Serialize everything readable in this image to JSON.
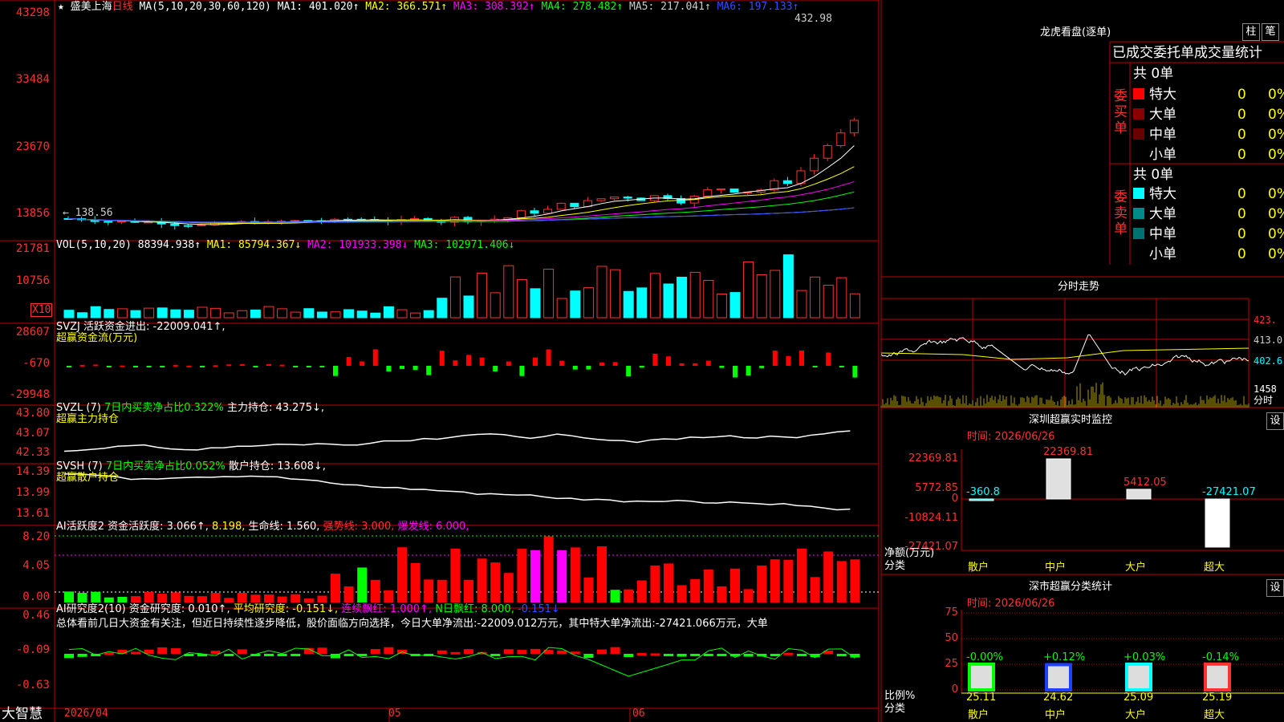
{
  "stock": {
    "name": "盛美上海",
    "period": "日线",
    "star": "★"
  },
  "main_panel": {
    "ma_label": "MA(5,10,20,30,60,120)",
    "ma1": "MA1: 401.020↑",
    "ma2": "MA2: 366.571↑",
    "ma3": "MA3: 308.392↑",
    "ma4": "MA4: 278.482↑",
    "ma5": "MA5: 217.041↑",
    "ma6": "MA6: 197.133↑",
    "yaxis": [
      "43298",
      "33484",
      "23670",
      "13856"
    ],
    "high_label": "432.98",
    "low_label": "← 138.56"
  },
  "vol_panel": {
    "title": "VOL(5,10,20)",
    "value": "88394.938↑",
    "ma1": "MA1: 85794.367↓",
    "ma2": "MA2: 101933.398↓",
    "ma3": "MA3: 102971.406↓",
    "yaxis": [
      "21781",
      "10756"
    ],
    "unit": "X10"
  },
  "svzj_panel": {
    "title": "SVZJ  活跃资金进出: -22009.041↑,",
    "subtitle": "超赢资金流(万元)",
    "yaxis": [
      "28607",
      "-670",
      "-29948"
    ]
  },
  "svzl_panel": {
    "title": "SVZL (7)",
    "ratio": "7日内买卖净占比0.322%",
    "hold": "主力持仓: 43.275↓,",
    "subtitle": "超赢主力持仓",
    "yaxis": [
      "43.80",
      "43.07",
      "42.33"
    ]
  },
  "svsh_panel": {
    "title": "SVSH (7)",
    "ratio": "7日内买卖净占比0.052%",
    "hold": "散户持仓: 13.608↓,",
    "subtitle": "超赢散户持仓",
    "yaxis": [
      "14.39",
      "13.99",
      "13.61"
    ]
  },
  "ai_active_panel": {
    "title": "AI活跃度2",
    "active": "资金活跃度: 3.066↑,",
    "v2": "8.198,",
    "life": "生命线: 1.560,",
    "strong": "强势线: 3.000,",
    "burst": "爆发线: 6.000,",
    "yaxis": [
      "8.20",
      "4.05",
      "0.00"
    ]
  },
  "ai_research_panel": {
    "title": "AI研究度2(10)",
    "research": "资金研究度: 0.010↑,",
    "avg": "平均研究度: -0.151↓,",
    "red": "连续飘红: 1.000↑,",
    "nred": "N日飘红: 8.000,",
    "last": "-0.151↓",
    "summary": "总体看前几日大资金有关注，但近日持续性逐步降低，股价面临方向选择，今日大单净流出:-22009.012万元，其中特大单净流出:-27421.066万元，大单",
    "yaxis": [
      "0.46",
      "-0.09",
      "-0.63"
    ]
  },
  "bottom_axis": {
    "brand": "大智慧",
    "dates": [
      "2026/04",
      "05",
      "06"
    ]
  },
  "dragon_tiger": {
    "title": "龙虎看盘(逐单)",
    "btn_bar": "柱",
    "btn_pen": "笔",
    "header": "已成交委托单成交量统计",
    "buy": {
      "side": "委买单",
      "total": "共 0单",
      "rows": [
        {
          "name": "特大",
          "count": "0",
          "pct": "0%"
        },
        {
          "name": "大单",
          "count": "0",
          "pct": "0%"
        },
        {
          "name": "中单",
          "count": "0",
          "pct": "0%"
        },
        {
          "name": "小单",
          "count": "0",
          "pct": "0%"
        }
      ]
    },
    "sell": {
      "side": "委卖单",
      "total": "共 0单",
      "rows": [
        {
          "name": "特大",
          "count": "0",
          "pct": "0%"
        },
        {
          "name": "大单",
          "count": "0",
          "pct": "0%"
        },
        {
          "name": "中单",
          "count": "0",
          "pct": "0%"
        },
        {
          "name": "小单",
          "count": "0",
          "pct": "0%"
        }
      ]
    },
    "colors": {
      "buy": [
        "#ff0000",
        "#8b0000",
        "#6b0000",
        "#000000"
      ],
      "sell": [
        "#00ffff",
        "#008b8b",
        "#007070",
        "#000000"
      ]
    }
  },
  "intraday": {
    "title": "分时走势",
    "yaxis": [
      "423.",
      "413.0",
      "402.6"
    ],
    "vol_label": "1458",
    "unit": "分时"
  },
  "sz_monitor": {
    "title": "深圳超赢实时监控",
    "btn": "设",
    "time": "时间: 2026/06/26",
    "yaxis": [
      "22369.81",
      "5772.85",
      "0",
      "-10824.11",
      "-27421.07"
    ],
    "left_label1": "净额(万元)",
    "left_label2": "分类",
    "categories": [
      "散户",
      "中户",
      "大户",
      "超大"
    ],
    "bar_labels": [
      "-360.8",
      "22369.81",
      "5412.05",
      "-27421.07"
    ]
  },
  "sz_stats": {
    "title": "深市超赢分类统计",
    "btn": "设",
    "time": "时间: 2026/06/26",
    "yaxis": [
      "75",
      "50",
      "25",
      "0"
    ],
    "left_label1": "比例%",
    "left_label2": "分类",
    "categories": [
      "散户",
      "中户",
      "大户",
      "超大"
    ],
    "changes": [
      "-0.00%",
      "+0.12%",
      "+0.03%",
      "-0.14%"
    ],
    "values": [
      "25.11",
      "24.62",
      "25.09",
      "25.19"
    ]
  },
  "chart_data": [
    {
      "type": "bar",
      "title": "深圳超赢实时监控",
      "categories": [
        "散户",
        "中户",
        "大户",
        "超大"
      ],
      "values": [
        -360.8,
        22369.81,
        5412.05,
        -27421.07
      ],
      "ylim": [
        -27421.07,
        22369.81
      ]
    },
    {
      "type": "bar",
      "title": "深市超赢分类统计",
      "categories": [
        "散户",
        "中户",
        "大户",
        "超大"
      ],
      "values": [
        25.11,
        24.62,
        25.09,
        25.19
      ],
      "ylim": [
        0,
        75
      ]
    }
  ]
}
